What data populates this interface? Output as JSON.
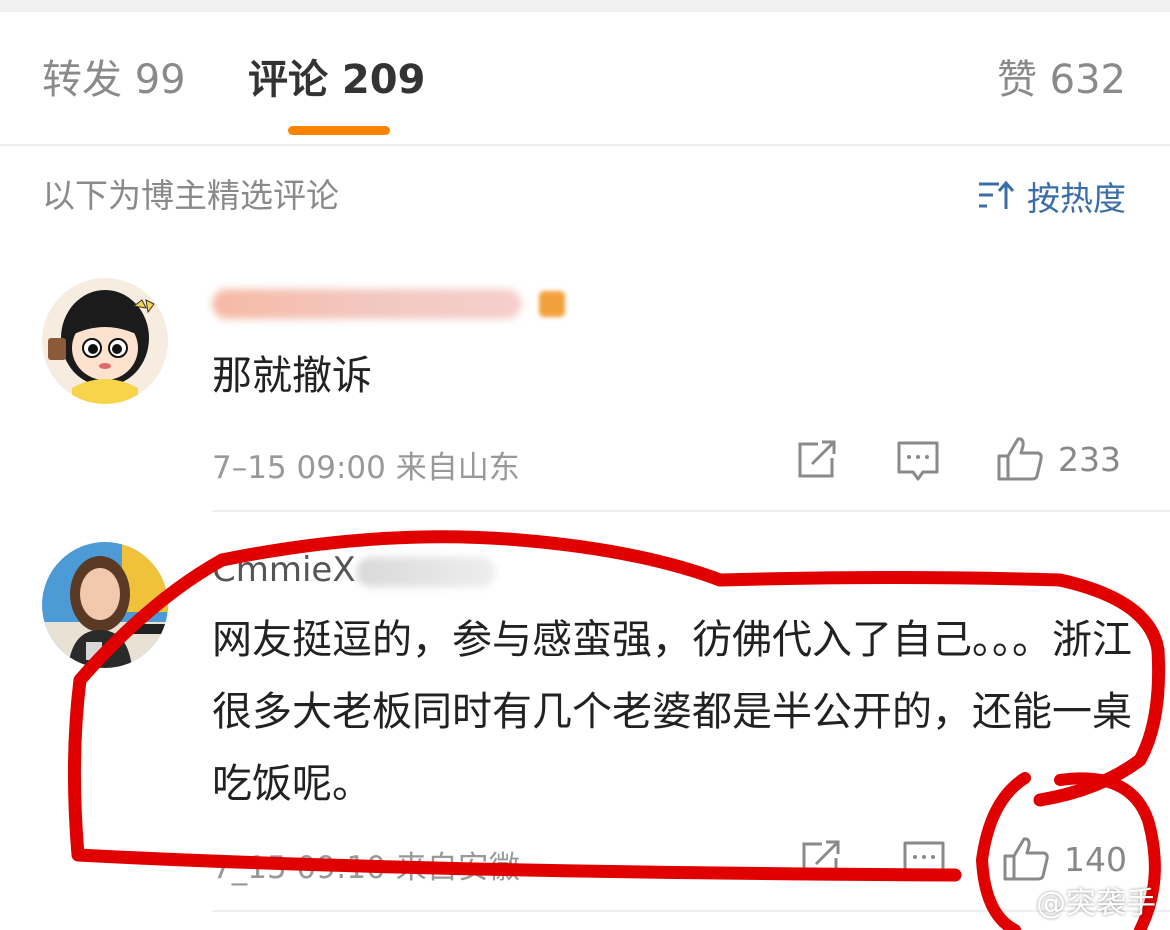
{
  "tabs": {
    "repost": "转发 99",
    "comment": "评论 209",
    "like": "赞 632"
  },
  "subheader": {
    "label": "以下为博主精选评论",
    "sort_label": "按热度"
  },
  "comments": [
    {
      "username_visible": "",
      "text": "那就撤诉",
      "meta": "7–15 09:00 来自山东",
      "likes": "233"
    },
    {
      "username_visible": "CmmieX",
      "text": "网友挺逗的，参与感蛮强，彷佛代入了自己。。。浙江很多大老板同时有几个老婆都是半公开的，还能一桌吃饭呢。",
      "meta": "7_15 09:10 来自安徽",
      "likes": "140"
    }
  ],
  "watermark": "@突袭手",
  "colors": {
    "accent": "#ff8200",
    "link": "#3b6ea8",
    "annotation": "#e00000"
  }
}
